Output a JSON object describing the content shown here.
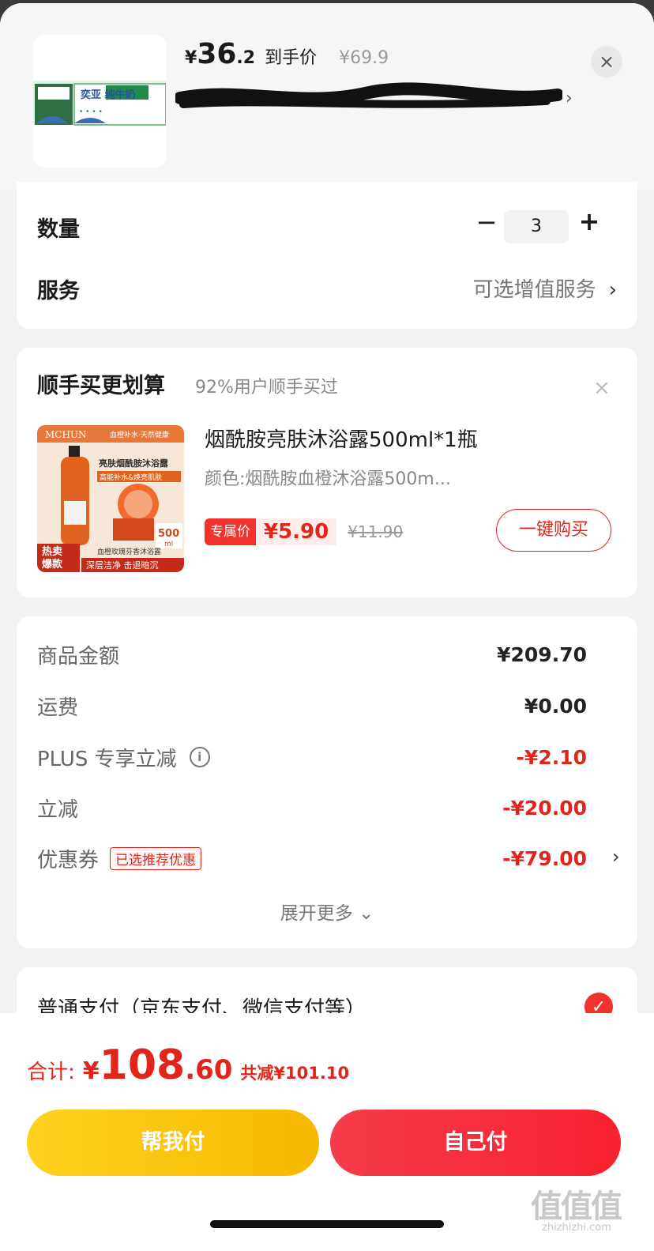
{
  "header": {
    "price_yen": "¥",
    "price_int": "36",
    "price_dec": ".2",
    "price_tag": "到手价",
    "price_orig": "¥69.9",
    "chevron": "›",
    "close": "×",
    "thumb_text": "奕亚 纯牛奶",
    "thumb_icon": "milk-box-product-image",
    "redacted_icon": "scribble-redaction"
  },
  "quantity": {
    "label": "数量",
    "minus": "−",
    "value": "3",
    "plus": "+"
  },
  "service": {
    "label": "服务",
    "value": "可选增值服务",
    "chevron": "›"
  },
  "upsell": {
    "title": "顺手买更划算",
    "subtitle": "92%用户顺手买过",
    "close": "×",
    "product": {
      "name": "烟酰胺亮肤沐浴露500ml*1瓶",
      "spec": "颜色:烟酰胺血橙沐浴露500m...",
      "promo_label": "专属价",
      "price": "¥5.90",
      "orig_price": "¥11.90",
      "buy_label": "一键购买",
      "img_brand": "MCHUN",
      "img_slogan": "血橙补水·天然健康",
      "img_title": "亮肤烟酰胺沐浴露",
      "img_tagline": "高能补水&焕亮肌肤",
      "img_volume": "500",
      "img_unit": "ml",
      "img_hot": "热卖",
      "img_hot2": "爆款",
      "img_desc": "血橙玫瑰芬香沐浴露",
      "img_footer": "深层洁净 击退暗沉"
    }
  },
  "fees": {
    "rows": [
      {
        "label": "商品金额",
        "value": "¥209.70"
      },
      {
        "label": "运费",
        "value": "¥0.00"
      },
      {
        "label": "PLUS 专享立减",
        "value": "-¥2.10"
      },
      {
        "label": "立减",
        "value": "-¥20.00"
      },
      {
        "label": "优惠券",
        "value": "-¥79.00"
      }
    ],
    "coupon_badge": "已选推荐优惠",
    "info_glyph": "i",
    "chevron": "›",
    "expand_label": "展开更多 ⌄",
    "colors": {
      "discount": "#e1251b",
      "normal": "#222222"
    }
  },
  "payment": {
    "label": "普通支付（京东支付、微信支付等）",
    "check": "✓"
  },
  "footer": {
    "total_label": "合计:",
    "total_yen": "¥",
    "total_int": "108",
    "total_dec": ".60",
    "total_saved": "共减¥101.10",
    "help_pay": "帮我付",
    "self_pay": "自己付",
    "watermark": "值值值",
    "watermark_sub": "zhizhizhi.com"
  },
  "colors": {
    "accent_red": "#e1251b",
    "help_yellow": "#f6b800",
    "self_red": "#f7212f"
  }
}
